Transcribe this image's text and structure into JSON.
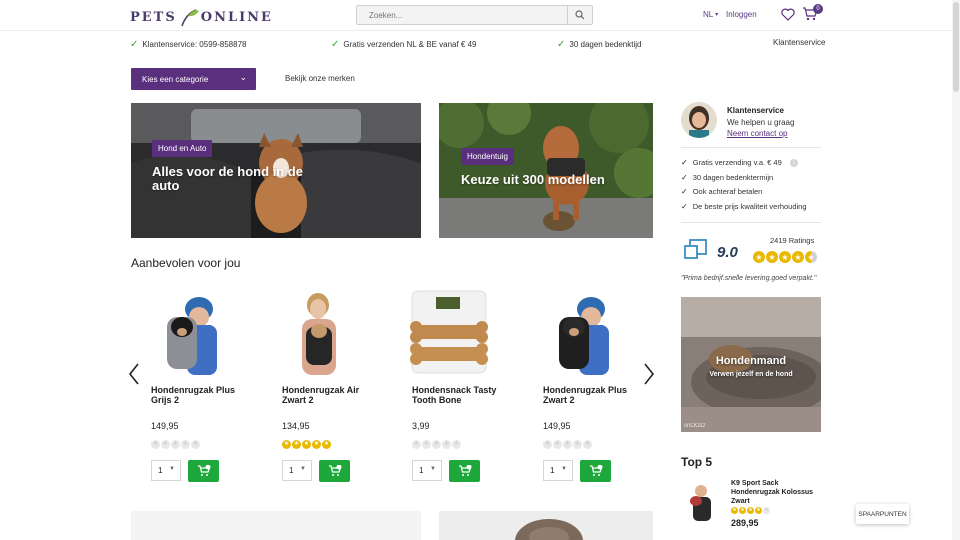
{
  "header": {
    "logo_text_left": "PETS",
    "logo_text_right": "ONLINE",
    "search_placeholder": "Zoeken...",
    "language": "NL",
    "login_label": "Inloggen",
    "cart_count": "0"
  },
  "usp": {
    "items": [
      {
        "label": "Klantenservice: 0599-858878"
      },
      {
        "label": "Gratis verzenden NL & BE vanaf € 49"
      },
      {
        "label": "30 dagen bedenktijd"
      }
    ],
    "right_link": "Klantenservice"
  },
  "nav": {
    "category_button": "Kies een categorie",
    "brands_link": "Bekijk onze merken"
  },
  "banners": [
    {
      "tag": "Hond en Auto",
      "headline": "Alles voor de hond in de auto"
    },
    {
      "tag": "Hondentuig",
      "headline": "Keuze uit 300 modellen"
    }
  ],
  "recommended": {
    "title": "Aanbevolen voor jou",
    "products": [
      {
        "name": "Hondenrugzak Plus Grijs 2",
        "price": "149,95",
        "rating": 0,
        "qty": "1"
      },
      {
        "name": "Hondenrugzak Air Zwart 2",
        "price": "134,95",
        "rating": 5,
        "qty": "1"
      },
      {
        "name": "Hondensnack Tasty Tooth Bone",
        "price": "3,99",
        "rating": 0,
        "qty": "1"
      },
      {
        "name": "Hondenrugzak Plus Zwart 2",
        "price": "149,95",
        "rating": 0,
        "qty": "1"
      }
    ]
  },
  "sidebar": {
    "service_title": "Klantenservice",
    "service_sub": "We helpen u graag",
    "service_link": "Neem contact op",
    "benefits": [
      {
        "label": "Gratis verzending v.a. € 49"
      },
      {
        "label": "30 dagen bedenktermijn"
      },
      {
        "label": "Ook achteraf betalen"
      },
      {
        "label": "De beste prijs kwaliteit verhouding"
      }
    ],
    "rating_score": "9.0",
    "rating_count": "2419 Ratings",
    "rating_stars": 4.5,
    "quote": "\"Prima bedrijf.snelle levering.goed verpakt.\"",
    "promo_title": "Hondenmand",
    "promo_sub": "Verwen jezelf en de hond",
    "promo_brand": "snOOzz",
    "top5_title": "Top 5",
    "top5_item_name": "K9 Sport Sack Hondenrugzak Kolossus Zwart",
    "top5_item_price": "289,95",
    "top5_item_rating": 4
  },
  "floating": {
    "spaarpunten": "SPAARPUNTEN"
  },
  "colors": {
    "brand_purple": "#5a2f7d",
    "cart_green": "#1ea83c",
    "star_yellow": "#e9b800",
    "check_green": "#3aa53a"
  }
}
